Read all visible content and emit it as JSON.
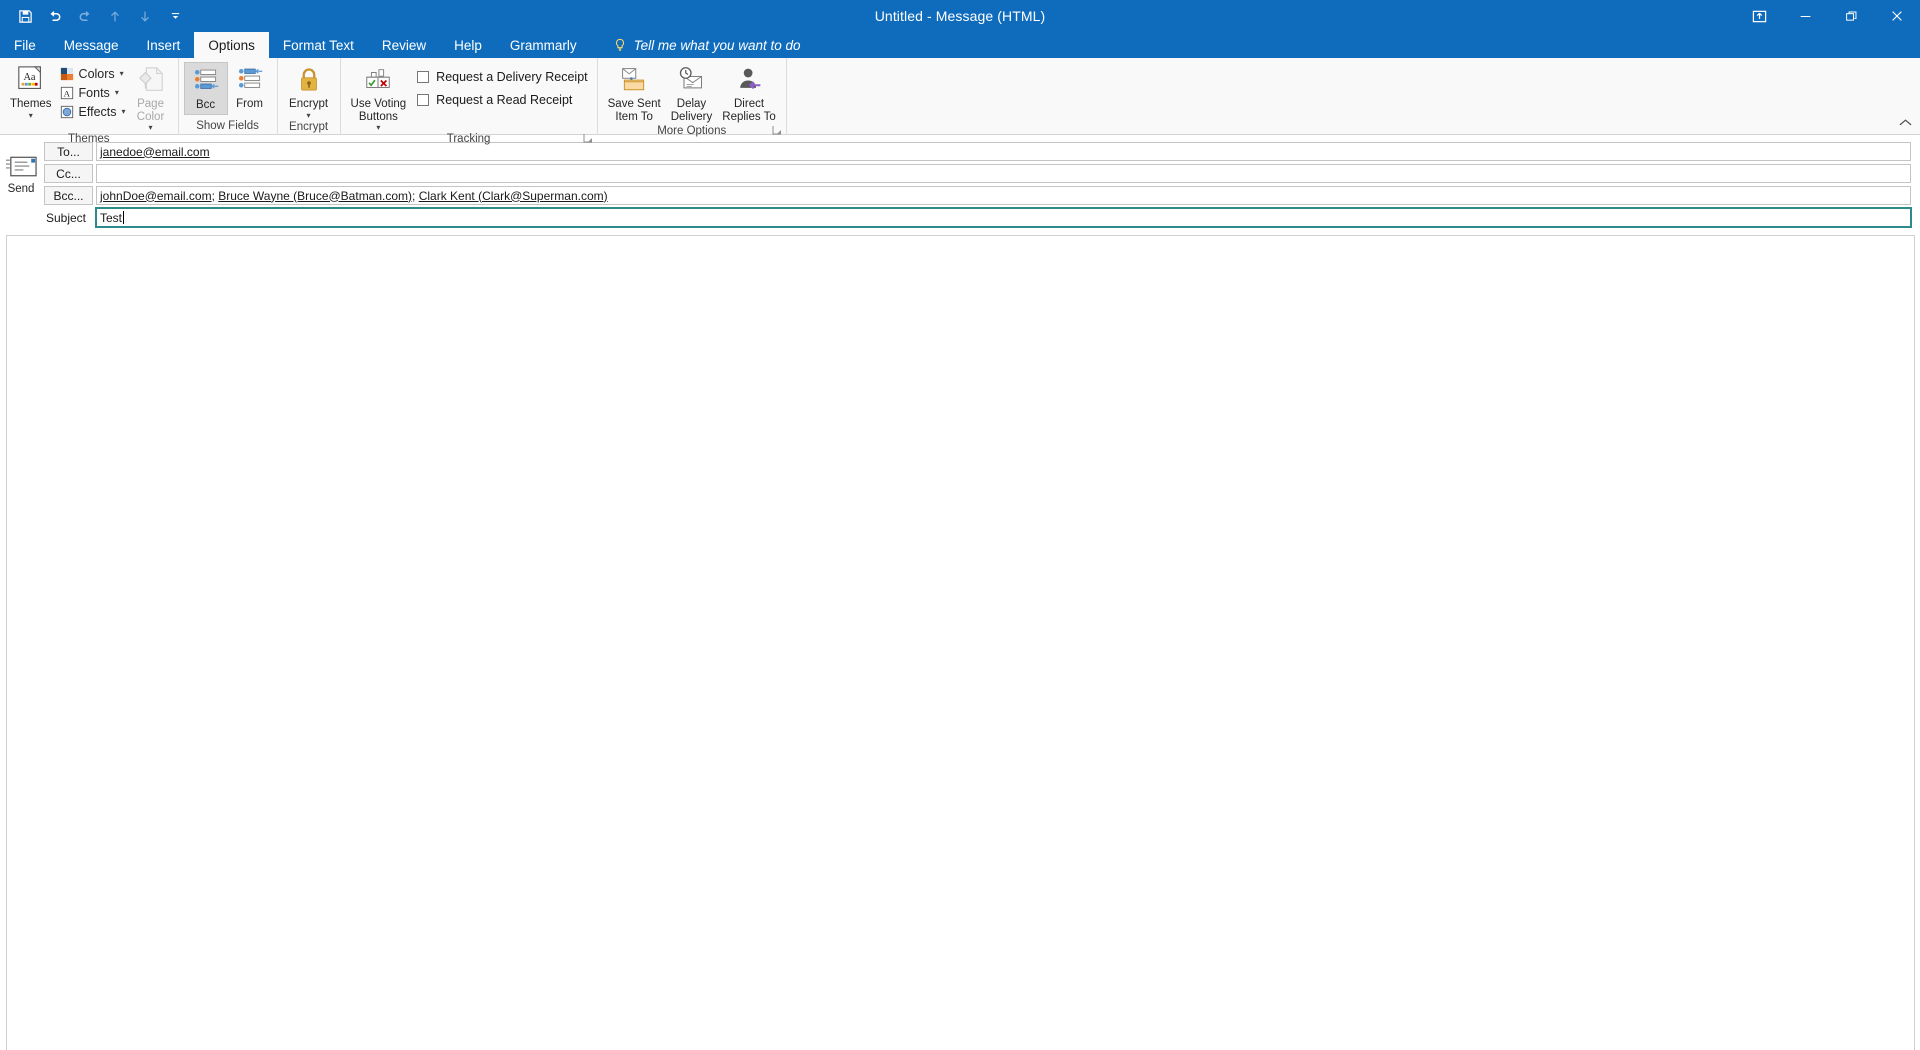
{
  "window": {
    "title": "Untitled  -  Message (HTML)",
    "quick_access": [
      {
        "name": "save",
        "icon": "save-icon",
        "enabled": true
      },
      {
        "name": "undo",
        "icon": "undo-icon",
        "enabled": true
      },
      {
        "name": "redo",
        "icon": "redo-icon",
        "enabled": false
      },
      {
        "name": "previous-item",
        "icon": "arrow-up-icon",
        "enabled": false
      },
      {
        "name": "next-item",
        "icon": "arrow-down-icon",
        "enabled": false
      },
      {
        "name": "customize",
        "icon": "chevron-down-bar-icon",
        "enabled": true
      }
    ],
    "controls": {
      "ribbon_display": "ribbon-display-options-icon",
      "minimize": "minimize-icon",
      "restore": "restore-icon",
      "close": "close-icon"
    }
  },
  "tabs": [
    {
      "label": "File",
      "active": false
    },
    {
      "label": "Message",
      "active": false
    },
    {
      "label": "Insert",
      "active": false
    },
    {
      "label": "Options",
      "active": true
    },
    {
      "label": "Format Text",
      "active": false
    },
    {
      "label": "Review",
      "active": false
    },
    {
      "label": "Help",
      "active": false
    },
    {
      "label": "Grammarly",
      "active": false
    }
  ],
  "tell_me": "Tell me what you want to do",
  "ribbon": {
    "groups": [
      {
        "label": "Themes",
        "big": [
          {
            "label": "Themes",
            "icon": "themes-icon",
            "has_caret": true,
            "disabled": false
          }
        ],
        "small": [
          {
            "label": "Colors",
            "icon": "colors-icon",
            "has_caret": true
          },
          {
            "label": "Fonts",
            "icon": "fonts-icon",
            "has_caret": true
          },
          {
            "label": "Effects",
            "icon": "effects-icon",
            "has_caret": true
          }
        ],
        "big2": [
          {
            "label": "Page\nColor",
            "icon": "page-color-icon",
            "has_caret": true,
            "disabled": true
          }
        ]
      },
      {
        "label": "Show Fields",
        "buttons": [
          {
            "label": "Bcc",
            "icon": "bcc-field-icon",
            "selected": true
          },
          {
            "label": "From",
            "icon": "from-field-icon",
            "selected": false
          }
        ]
      },
      {
        "label": "Encrypt",
        "buttons": [
          {
            "label": "Encrypt",
            "icon": "lock-icon",
            "has_caret": true,
            "selected": false
          }
        ]
      },
      {
        "label": "Tracking",
        "has_dialog_launcher": true,
        "buttons": [
          {
            "label": "Use Voting\nButtons",
            "icon": "voting-buttons-icon",
            "has_caret": true
          }
        ],
        "checkboxes": [
          {
            "label": "Request a Delivery Receipt",
            "checked": false
          },
          {
            "label": "Request a Read Receipt",
            "checked": false
          }
        ]
      },
      {
        "label": "More Options",
        "has_dialog_launcher": true,
        "buttons": [
          {
            "label": "Save Sent\nItem To",
            "icon": "save-sent-item-icon",
            "has_caret": true
          },
          {
            "label": "Delay\nDelivery",
            "icon": "delay-delivery-icon",
            "has_caret": false
          },
          {
            "label": "Direct\nReplies To",
            "icon": "direct-replies-icon",
            "has_caret": false
          }
        ]
      }
    ],
    "collapse_icon": "chevron-up-icon"
  },
  "compose": {
    "send_button": {
      "label": "Send",
      "icon": "send-icon"
    },
    "to": {
      "button_label": "To...",
      "value": "janedoe@email.com"
    },
    "cc": {
      "button_label": "Cc...",
      "value": ""
    },
    "bcc": {
      "button_label": "Bcc...",
      "recipients": [
        "johnDoe@email.com",
        "Bruce Wayne (Bruce@Batman.com)",
        "Clark Kent (Clark@Superman.com)"
      ],
      "separator": "; "
    },
    "subject": {
      "label": "Subject",
      "value": "Test",
      "focused": true
    },
    "body": {
      "value": ""
    }
  },
  "colors": {
    "accent": "#0f6cbd",
    "ribbon_bg": "#f9f9f9",
    "focus_border": "#2e8b8b",
    "lock_gold": "#d9a227"
  }
}
